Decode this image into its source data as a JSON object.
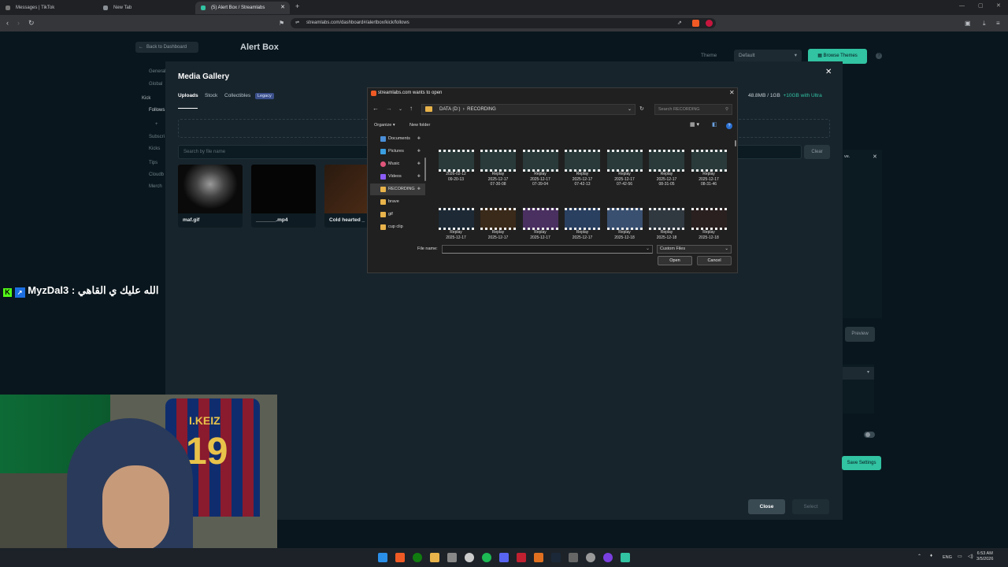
{
  "browser": {
    "tabs": [
      {
        "title": "Messages | TikTok"
      },
      {
        "title": "New Tab"
      },
      {
        "title": "(5) Alert Box / Streamlabs"
      }
    ],
    "new_tab": "+",
    "url": "streamlabs.com/dashboard#/alertbox/kick/follows"
  },
  "page": {
    "back_label": "Back to Dashboard",
    "title": "Alert Box",
    "theme_label": "Theme",
    "theme_value": "Default",
    "browse_themes": "Browse Themes",
    "sidebar": [
      "General",
      "Global",
      "Kick",
      "Follows",
      "+",
      "Subscri",
      "Kicks",
      "Tips",
      "Cloudb",
      "Merch"
    ],
    "preview_label": "Preview",
    "save_settings": "Save Settings",
    "panel_label": "ve."
  },
  "modal": {
    "title": "Media Gallery",
    "tabs": [
      "Uploads",
      "Stock",
      "Collectibles"
    ],
    "legacy_badge": "Legacy",
    "storage_used": "48.8MB / 1GB",
    "storage_upgrade": "+10GB with Ultra",
    "search_placeholder": "Search by file name",
    "clear_label": "Clear",
    "media": [
      {
        "name": "maf.gif"
      },
      {
        "name": "_______.mp4"
      },
      {
        "name": "Cold hearted _"
      }
    ],
    "close_label": "Close",
    "select_label": "Select"
  },
  "file_dialog": {
    "title": "streamlabs.com wants to open",
    "path": [
      "DATA (D:)",
      "RECORDING"
    ],
    "search_placeholder": "Search RECORDING",
    "organize": "Organize",
    "new_folder": "New folder",
    "nav": [
      {
        "label": "Documents",
        "color": "#4a8fd8"
      },
      {
        "label": "Pictures",
        "color": "#3a9ee0"
      },
      {
        "label": "Music",
        "color": "#e0557a"
      },
      {
        "label": "Videos",
        "color": "#8b5cf6"
      },
      {
        "label": "RECORDING",
        "color": "#e8b34a"
      },
      {
        "label": "brave",
        "color": "#e8b34a"
      },
      {
        "label": "gif",
        "color": "#e8b34a"
      },
      {
        "label": "cup clip",
        "color": "#e8b34a"
      }
    ],
    "files_row1": [
      {
        "line1": "2026-02-12",
        "line2": "09-20-13"
      },
      {
        "line1": "Replay",
        "line2": "2025-12-17",
        "line3": "07-30-08"
      },
      {
        "line1": "Replay",
        "line2": "2025-12-17",
        "line3": "07-39-04"
      },
      {
        "line1": "Replay",
        "line2": "2025-12-17",
        "line3": "07-42-13"
      },
      {
        "line1": "Replay",
        "line2": "2025-12-17",
        "line3": "07-42-56"
      },
      {
        "line1": "Replay",
        "line2": "2025-12-17",
        "line3": "08-31-05"
      },
      {
        "line1": "Replay",
        "line2": "2025-12-17",
        "line3": "08-31-46"
      }
    ],
    "files_row2": [
      {
        "line1": "Replay",
        "line2": "2025-12-17"
      },
      {
        "line1": "Replay",
        "line2": "2025-12-17"
      },
      {
        "line1": "Replay",
        "line2": "2025-12-17"
      },
      {
        "line1": "Replay",
        "line2": "2025-12-17"
      },
      {
        "line1": "Replay",
        "line2": "2025-12-18"
      },
      {
        "line1": "Replay",
        "line2": "2025-12-18"
      },
      {
        "line1": "Replay",
        "line2": "2025-12-18"
      }
    ],
    "file_name_label": "File name:",
    "file_name_value": "",
    "file_type": "Custom Files",
    "open_label": "Open",
    "cancel_label": "Cancel"
  },
  "overlay": {
    "chat_user": "MyzDal3 :",
    "chat_message": "الله عليك ي القاهي"
  },
  "webcam": {
    "jersey_name": "I.KEIZ",
    "jersey_number": "19"
  },
  "taskbar": {
    "lang": "ENG",
    "time": "6:53 AM",
    "date": "3/5/2026"
  }
}
